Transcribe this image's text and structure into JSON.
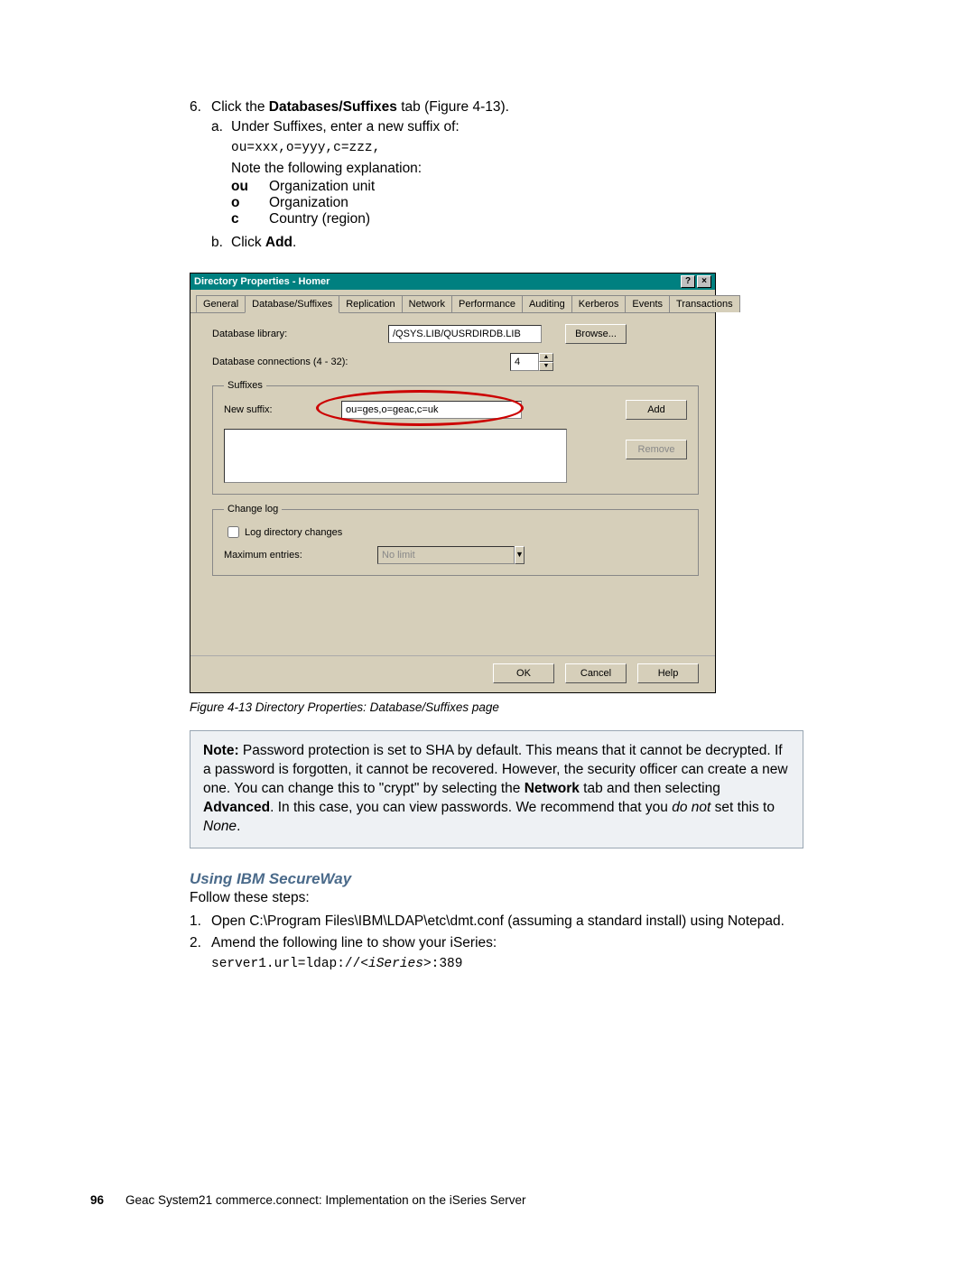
{
  "step6": {
    "num": "6.",
    "pre": "Click the ",
    "bold": "Databases/Suffixes",
    "post": " tab (Figure 4-13).",
    "a": {
      "num": "a.",
      "text": "Under Suffixes, enter a new suffix of:"
    },
    "code": "ou=xxx,o=yyy,c=zzz,",
    "explain": "Note the following explanation:",
    "defs": {
      "ou": {
        "k": "ou",
        "v": "Organization unit"
      },
      "o": {
        "k": "o",
        "v": "Organization"
      },
      "c": {
        "k": "c",
        "v": "Country (region)"
      }
    },
    "b": {
      "num": "b.",
      "pre": "Click ",
      "bold": "Add",
      "post": "."
    }
  },
  "dialog": {
    "title": "Directory Properties - Homer",
    "help_btn": "?",
    "close_btn": "×",
    "tabs": [
      "General",
      "Database/Suffixes",
      "Replication",
      "Network",
      "Performance",
      "Auditing",
      "Kerberos",
      "Events",
      "Transactions"
    ],
    "active_tab": 1,
    "db_library_label": "Database library:",
    "db_library_value": "/QSYS.LIB/QUSRDIRDB.LIB",
    "browse": "Browse...",
    "db_conn_label": "Database connections (4 - 32):",
    "db_conn_value": "4",
    "suffixes_legend": "Suffixes",
    "new_suffix_label": "New suffix:",
    "new_suffix_value": "ou=ges,o=geac,c=uk",
    "add_btn": "Add",
    "remove_btn": "Remove",
    "changelog_legend": "Change log",
    "log_changes_label": "Log directory changes",
    "max_entries_label": "Maximum entries:",
    "max_entries_value": "No limit",
    "ok": "OK",
    "cancel": "Cancel",
    "helpb": "Help"
  },
  "figcap": "Figure 4-13   Directory Properties: Database/Suffixes page",
  "note": {
    "bold1": "Note:",
    "t1": " Password protection is set to SHA by default. This means that it cannot be decrypted. If a password is forgotten, it cannot be recovered. However, the security officer can create a new one. You can change this to \"crypt\" by selecting the ",
    "bold2": "Network",
    "t2": " tab and then selecting ",
    "bold3": "Advanced",
    "t3": ". In this case, you can view passwords. We recommend that you ",
    "ital1": "do not",
    "t4": " set this to ",
    "ital2": "None",
    "t5": "."
  },
  "secureway": {
    "heading": "Using IBM SecureWay",
    "intro": "Follow these steps:",
    "s1": {
      "num": "1.",
      "text": "Open C:\\Program Files\\IBM\\LDAP\\etc\\dmt.conf (assuming a standard install) using Notepad."
    },
    "s2": {
      "num": "2.",
      "text": "Amend the following line to show your iSeries:"
    },
    "code_pre": "server1.url=ldap://",
    "code_ital": "<iSeries>",
    "code_post": ":389"
  },
  "footer": {
    "page": "96",
    "text": "Geac System21 commerce.connect: Implementation on the iSeries Server"
  }
}
